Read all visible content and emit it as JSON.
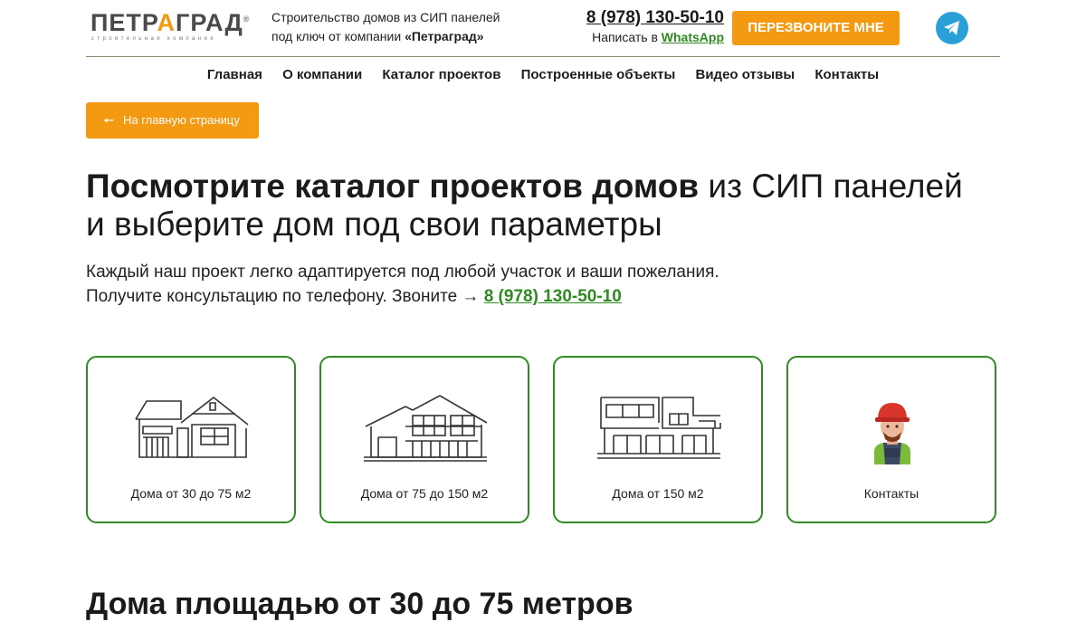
{
  "header": {
    "logo": {
      "prefix": "ПЕТР",
      "accent": "А",
      "suffix": "ГРАД",
      "reg": "®",
      "tagline": "строительная компания"
    },
    "tagline_line1": "Строительство домов из СИП панелей",
    "tagline_line2_prefix": "под ключ от компании ",
    "tagline_line2_bold": "«Петраград»",
    "phone": "8 (978) 130-50-10",
    "write_prefix": "Написать в ",
    "write_link": "WhatsApp",
    "callback_label": "ПЕРЕЗВОНИТЕ МНЕ",
    "telegram_icon": "telegram-icon"
  },
  "nav": {
    "items": [
      "Главная",
      "О компании",
      "Каталог проектов",
      "Построенные объекты",
      "Видео отзывы",
      "Контакты"
    ]
  },
  "back_button": {
    "label": "На главную страницу",
    "icon": "arrow-left-icon"
  },
  "hero": {
    "title_bold": "Посмотрите каталог проектов домов",
    "title_rest_line1": " из СИП панелей",
    "title_line2": "и выберите дом под свои параметры",
    "intro_line1": "Каждый наш проект легко адаптируется под любой участок и ваши пожелания.",
    "intro_line2_prefix": "Получите консультацию по телефону. Звоните → ",
    "intro_phone": "8 (978) 130-50-10"
  },
  "cards": [
    {
      "label": "Дома от 30 до 75 м2",
      "icon": "small-house-icon"
    },
    {
      "label": "Дома от 75 до 150 м2",
      "icon": "medium-house-icon"
    },
    {
      "label": "Дома от 150 м2",
      "icon": "large-house-icon"
    },
    {
      "label": "Контакты",
      "icon": "builder-icon"
    }
  ],
  "section_title": "Дома площадью от 30 до 75 метров",
  "colors": {
    "accent": "#f39a12",
    "green": "#2f8a22",
    "telegram": "#2aa0d9"
  }
}
